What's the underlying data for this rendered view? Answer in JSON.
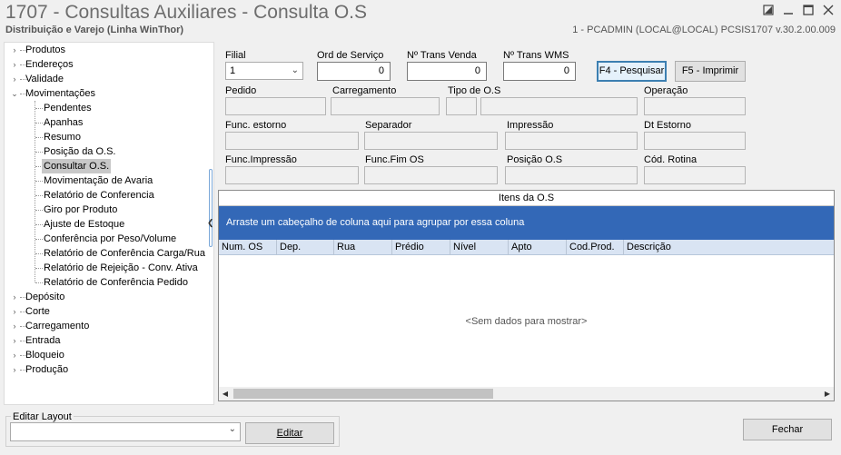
{
  "window": {
    "title": "1707 - Consultas Auxiliares - Consulta O.S",
    "subtitle": "Distribuição e Varejo (Linha WinThor)",
    "status": "1 - PCADMIN (LOCAL@LOCAL)   PCSIS1707  v.30.2.00.009",
    "icons": [
      "restore-icon",
      "minimize-icon",
      "maximize-icon",
      "close-icon"
    ]
  },
  "tree": {
    "top": [
      {
        "label": "Produtos",
        "expanded": false
      },
      {
        "label": "Endereços",
        "expanded": false
      },
      {
        "label": "Validade",
        "expanded": false
      },
      {
        "label": "Movimentações",
        "expanded": true
      }
    ],
    "children": [
      "Pendentes",
      "Apanhas",
      "Resumo",
      "Posição da O.S.",
      "Consultar O.S.",
      "Movimentação de Avaria",
      "Relatório de Conferencia",
      "Giro por Produto",
      "Ajuste de Estoque",
      "Conferência por Peso/Volume",
      "Relatório de Conferência Carga/Rua",
      "Relatório de Rejeição - Conv. Ativa",
      "Relatório de Conferência Pedido"
    ],
    "selected": "Consultar O.S.",
    "bottom": [
      {
        "label": "Depósito"
      },
      {
        "label": "Corte"
      },
      {
        "label": "Carregamento"
      },
      {
        "label": "Entrada"
      },
      {
        "label": "Bloqueio"
      },
      {
        "label": "Produção"
      }
    ]
  },
  "form": {
    "filial_label": "Filial",
    "filial_value": "1",
    "ord_servico_label": "Ord de Serviço",
    "ord_servico_value": "0",
    "trans_venda_label": "Nº Trans Venda",
    "trans_venda_value": "0",
    "trans_wms_label": "Nº Trans WMS",
    "trans_wms_value": "0",
    "pesquisar_label": "F4 - Pesquisar",
    "imprimir_label": "F5 - Imprimir",
    "pedido_label": "Pedido",
    "carregamento_label": "Carregamento",
    "tipo_os_label": "Tipo de O.S",
    "operacao_label": "Operação",
    "func_estorno_label": "Func. estorno",
    "separador_label": "Separador",
    "impressao_label": "Impressão",
    "dt_estorno_label": "Dt Estorno",
    "func_impressao_label": "Func.Impressão",
    "func_fim_os_label": "Func.Fim OS",
    "posicao_os_label": "Posição O.S",
    "cod_rotina_label": "Cód. Rotina"
  },
  "grid": {
    "title": "Itens da O.S",
    "group_hint": "Arraste um cabeçalho de coluna aqui para agrupar por essa coluna",
    "columns": [
      "Num. OS",
      "Dep.",
      "Rua",
      "Prédio",
      "Nível",
      "Apto",
      "Cod.Prod.",
      "Descrição"
    ],
    "empty_text": "<Sem dados para mostrar>"
  },
  "bottom": {
    "layout_legend": "Editar Layout",
    "editar_label": "Editar",
    "fechar_label": "Fechar"
  }
}
